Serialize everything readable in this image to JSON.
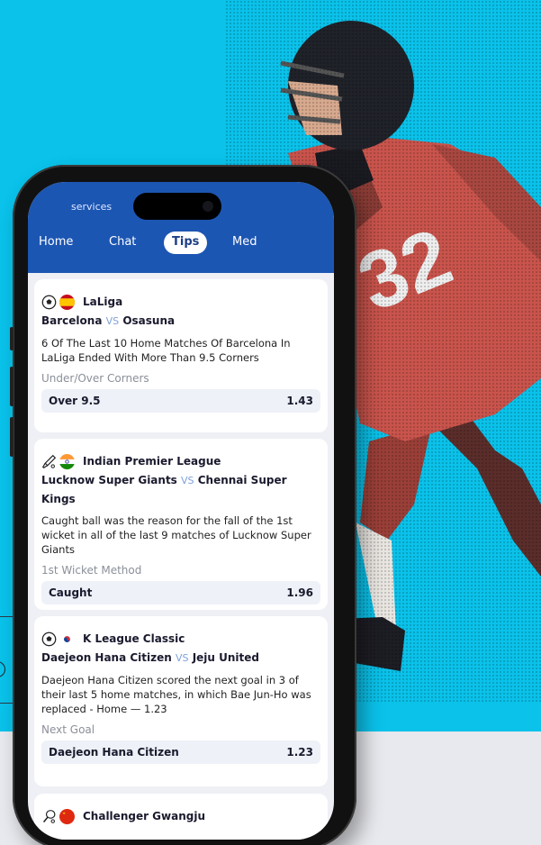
{
  "header": {
    "label": "services",
    "tabs": [
      {
        "label": "Home"
      },
      {
        "label": "Chat"
      },
      {
        "label": "Tips"
      },
      {
        "label": "Med"
      }
    ]
  },
  "tips": [
    {
      "sport_icon": "soccer-ball-icon",
      "flag_icon": "spain-flag-icon",
      "league": "LaLiga",
      "home": "Barcelona",
      "vs": "VS",
      "away": "Osasuna",
      "description": "6 Of The Last 10 Home Matches Of Barcelona In LaLiga Ended With More Than 9.5 Corners",
      "market": "Under/Over Corners",
      "pick": "Over 9.5",
      "odds": "1.43"
    },
    {
      "sport_icon": "cricket-bat-icon",
      "flag_icon": "india-flag-icon",
      "league": "Indian Premier League",
      "home": "Lucknow Super Giants",
      "vs": "VS",
      "away": "Chennai Super Kings",
      "description": "Caught ball was the reason for the fall of the 1st wicket in all of the last 9 matches of Lucknow Super Giants",
      "market": "1st Wicket Method",
      "pick": "Caught",
      "odds": "1.96"
    },
    {
      "sport_icon": "soccer-ball-icon",
      "flag_icon": "south-korea-flag-icon",
      "league": "K League Classic",
      "home": "Daejeon Hana Citizen",
      "vs": "VS",
      "away": "Jeju United",
      "description": "Daejeon Hana Citizen scored the next goal in 3 of their last 5 home matches, in which Bae Jun-Ho was replaced - Home — 1.23",
      "market": "Next Goal",
      "pick": "Daejeon Hana Citizen",
      "odds": "1.23"
    },
    {
      "sport_icon": "tennis-racket-icon",
      "flag_icon": "china-flag-icon",
      "league": "Challenger Gwangju"
    }
  ],
  "colors": {
    "background": "#0ac2ea",
    "header": "#1c56b3",
    "vs": "#7da2d6",
    "jersey": "#c9544c"
  }
}
